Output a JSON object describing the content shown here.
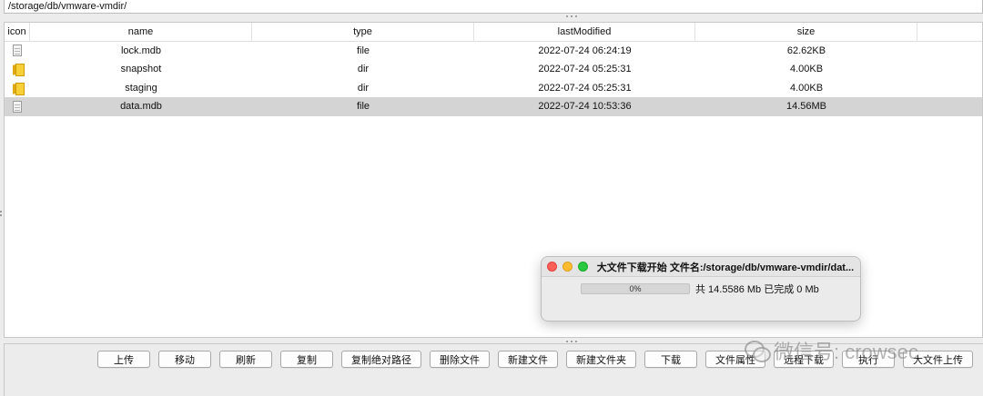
{
  "path": "/storage/db/vmware-vmdir/",
  "table": {
    "columns": [
      "icon",
      "name",
      "type",
      "lastModified",
      "size"
    ],
    "rows": [
      {
        "icon": "file-icon",
        "name": "lock.mdb",
        "type": "file",
        "lastModified": "2022-07-24 06:24:19",
        "size": "62.62KB",
        "selected": false
      },
      {
        "icon": "folder-icon",
        "name": "snapshot",
        "type": "dir",
        "lastModified": "2022-07-24 05:25:31",
        "size": "4.00KB",
        "selected": false
      },
      {
        "icon": "folder-icon",
        "name": "staging",
        "type": "dir",
        "lastModified": "2022-07-24 05:25:31",
        "size": "4.00KB",
        "selected": false
      },
      {
        "icon": "file-icon",
        "name": "data.mdb",
        "type": "file",
        "lastModified": "2022-07-24 10:53:36",
        "size": "14.56MB",
        "selected": true
      }
    ]
  },
  "buttons": [
    "上传",
    "移动",
    "刷新",
    "复制",
    "复制绝对路径",
    "删除文件",
    "新建文件",
    "新建文件夹",
    "下载",
    "文件属性",
    "远程下载",
    "执行",
    "大文件上传"
  ],
  "dialog": {
    "title": "大文件下载开始 文件名:/storage/db/vmware-vmdir/dat...",
    "progress_label": "0%",
    "progress_value": 0,
    "info": "共  14.5586 Mb  已完成   0 Mb"
  },
  "watermark": "微信号: crowsec",
  "colors": {
    "selected_row": "#d4d4d4",
    "traffic_red": "#ff5f57",
    "traffic_yellow": "#febc2e",
    "traffic_green": "#28c840"
  }
}
